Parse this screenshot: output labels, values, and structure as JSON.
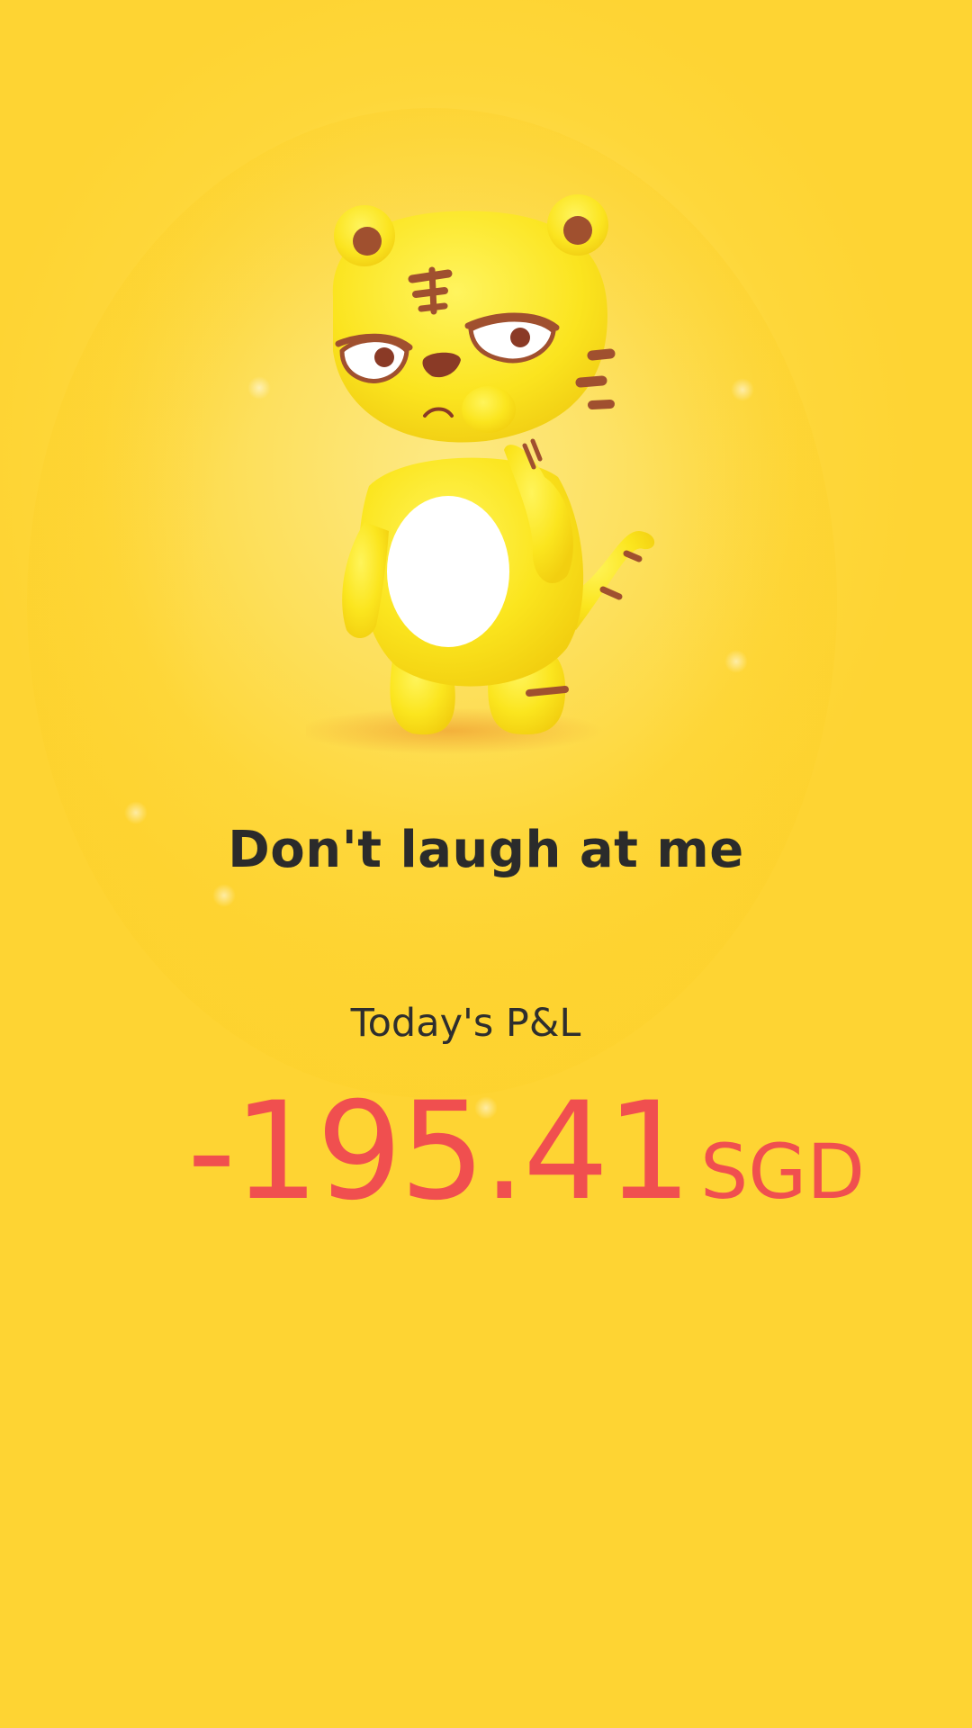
{
  "mascot": {
    "icon": "tiger-mascot-icon",
    "mood": "grumpy"
  },
  "headline": "Don't laugh at me",
  "pnl": {
    "label": "Today's P&L",
    "amount": "-195.41",
    "currency": "SGD"
  },
  "colors": {
    "background": "#fed433",
    "headline": "#2b2b2b",
    "loss": "#f04f4f",
    "mascot_body": "#fbe51e",
    "mascot_stripes": "#a0502f"
  }
}
